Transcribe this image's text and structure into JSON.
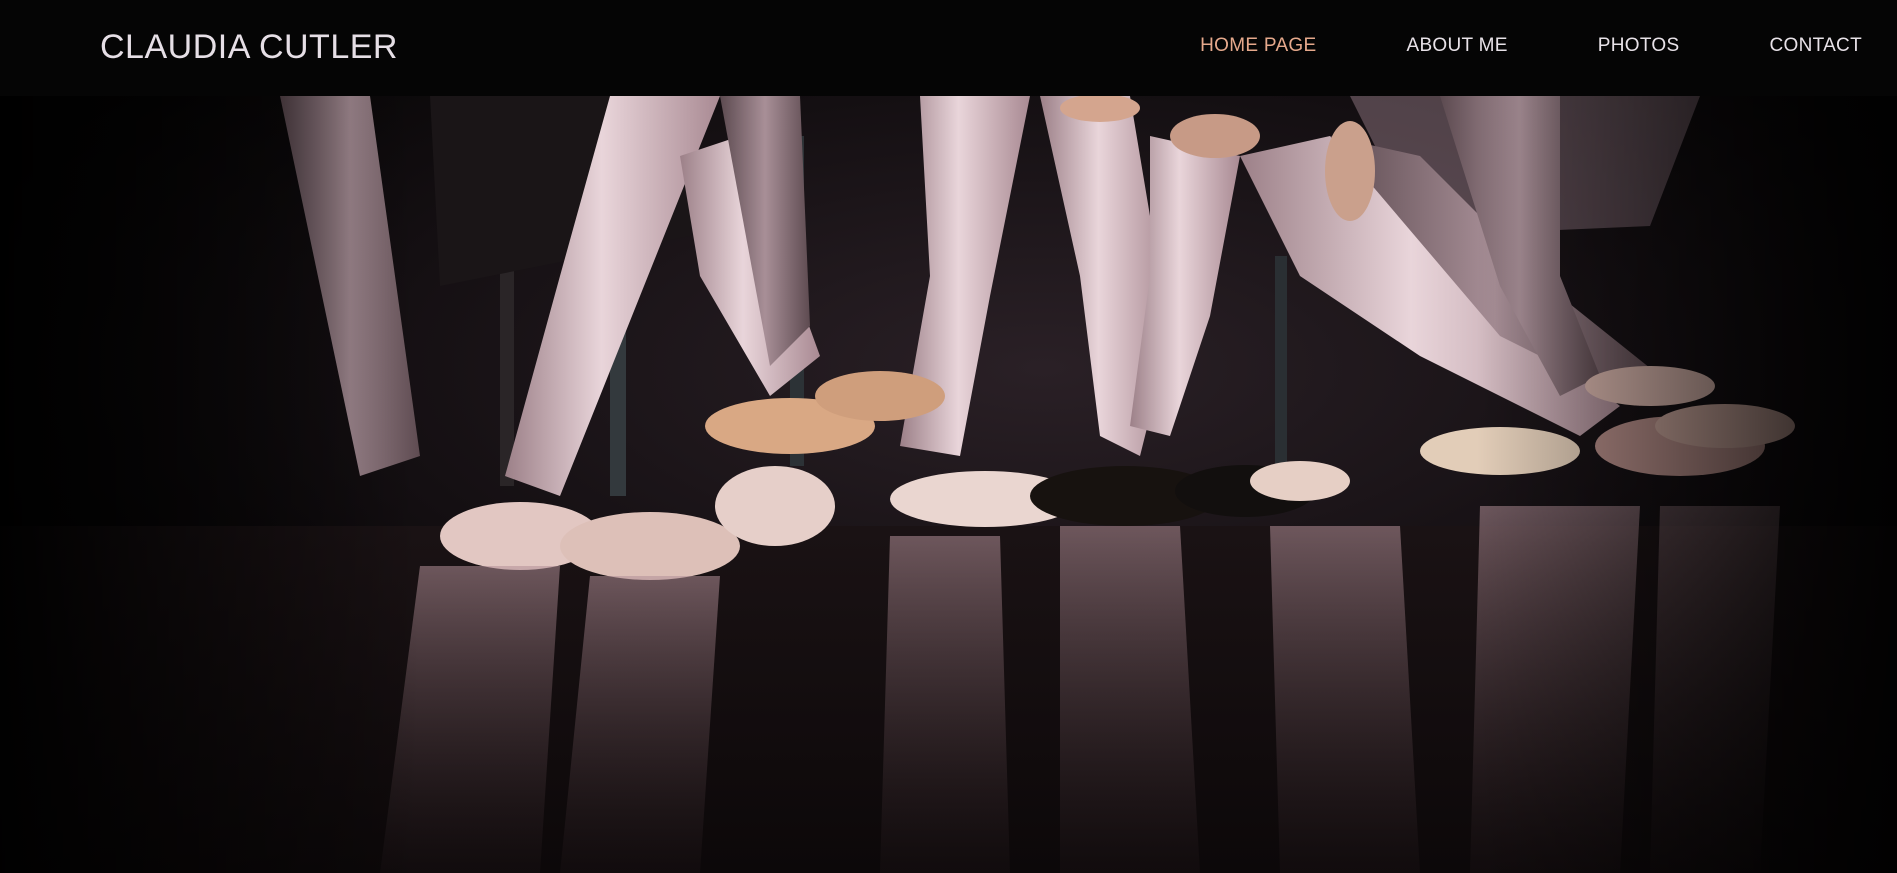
{
  "brand": {
    "name": "CLAUDIA CUTLER"
  },
  "nav": {
    "items": [
      {
        "label": "HOME PAGE",
        "active": true
      },
      {
        "label": "ABOUT ME",
        "active": false
      },
      {
        "label": "PHOTOS",
        "active": false
      },
      {
        "label": "CONTACT",
        "active": false
      }
    ]
  },
  "colors": {
    "background": "#050505",
    "text": "#e8e2e8",
    "active_link": "#e6a98c"
  },
  "hero": {
    "image": "ballet-dancers-legs-photo"
  }
}
